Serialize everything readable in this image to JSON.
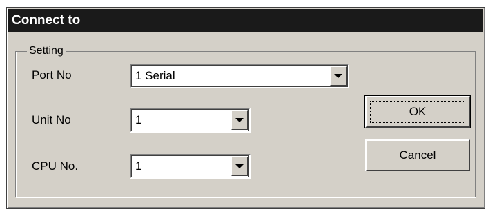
{
  "dialog": {
    "title": "Connect to"
  },
  "setting_group": {
    "legend": "Setting",
    "port": {
      "label": "Port No",
      "value": "1 Serial"
    },
    "unit": {
      "label": "Unit No",
      "value": "1"
    },
    "cpu": {
      "label": "CPU No.",
      "value": "1"
    }
  },
  "buttons": {
    "ok_label": "OK",
    "cancel_label": "Cancel"
  },
  "icons": {
    "dropdown": "chevron-down-icon"
  },
  "colors": {
    "titlebar": "#1a1a1a",
    "face": "#d4d0c8",
    "field": "#ffffff"
  }
}
